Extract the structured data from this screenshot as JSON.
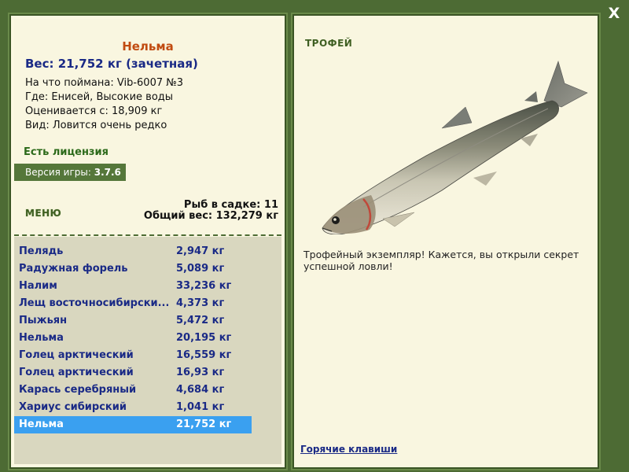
{
  "close_label": "X",
  "fish": {
    "name": "Нельма",
    "weight_line": "Вес: 21,752 кг (зачетная)",
    "caught_on": "На что поймана: Vib-6007 №3",
    "where": "Где: Енисей, Высокие воды",
    "rated_from": "Оценивается с: 18,909 кг",
    "kind": "Вид: Ловится очень редко"
  },
  "license": "Есть лицензия",
  "version": {
    "label": "Версия игры:",
    "value": "3.7.6"
  },
  "menu_label": "МЕНЮ",
  "keepnet": {
    "count_line": "Рыб в садке: 11",
    "total_line": "Общий вес: 132,279 кг"
  },
  "catch_list": [
    {
      "name": "Пелядь",
      "weight": "2,947 кг"
    },
    {
      "name": "Радужная форель",
      "weight": "5,089 кг"
    },
    {
      "name": "Налим",
      "weight": "33,236 кг"
    },
    {
      "name": "Лещ восточносибирски...",
      "weight": "4,373 кг"
    },
    {
      "name": "Пыжьян",
      "weight": "5,472 кг"
    },
    {
      "name": "Нельма",
      "weight": "20,195 кг"
    },
    {
      "name": "Голец арктический",
      "weight": "16,559 кг"
    },
    {
      "name": "Голец арктический",
      "weight": "16,93 кг"
    },
    {
      "name": "Карась серебряный",
      "weight": "4,684 кг"
    },
    {
      "name": "Хариус сибирский",
      "weight": "1,041 кг"
    },
    {
      "name": "Нельма",
      "weight": "21,752 кг"
    }
  ],
  "selected_index": 10,
  "trophy": {
    "title": "ТРОФЕЙ",
    "text": "Трофейный экземпляр! Кажется, вы открыли секрет успешной ловли!"
  },
  "hotkeys_label": "Горячие клавиши",
  "colors": {
    "frame_green": "#4d6b34",
    "panel_bg": "#f9f6e0",
    "title_orange": "#c14b11",
    "text_navy": "#1a2a86",
    "selected_blue": "#3aa0f0"
  }
}
